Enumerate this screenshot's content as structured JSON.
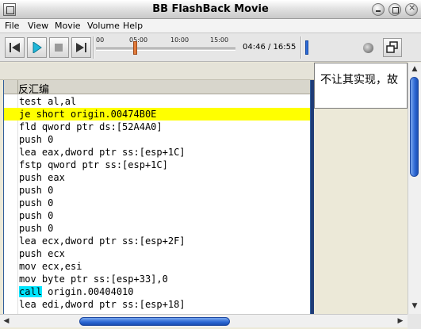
{
  "window": {
    "title": "BB FlashBack Movie"
  },
  "menu": {
    "items": [
      "File",
      "View",
      "Movie",
      "Volume",
      "Help"
    ]
  },
  "toolbar": {
    "timeline_ticks": [
      "00",
      "05:00",
      "10:00",
      "15:00"
    ],
    "time_display": "04:46 / 16:55",
    "playback_progress": 0.28
  },
  "code_panel": {
    "header": "反汇编",
    "lines": [
      "test al,al",
      "je short origin.00474B0E",
      "fld qword ptr ds:[52A4A0]",
      "push 0",
      "lea eax,dword ptr ss:[esp+1C]",
      "fstp qword ptr ss:[esp+1C]",
      "push eax",
      "push 0",
      "push 0",
      "push 0",
      "push 0",
      "lea ecx,dword ptr ss:[esp+2F]",
      "push ecx",
      "mov ecx,esi",
      "mov byte ptr ss:[esp+33],0"
    ],
    "call_keyword": "call",
    "call_rest": " origin.00404010",
    "last_line": "lea edi,dword ptr ss:[esp+18]",
    "highlight_color": "#ffff00",
    "call_color": "#00e5ff"
  },
  "side_panel": {
    "text": "不让其实现，故"
  }
}
